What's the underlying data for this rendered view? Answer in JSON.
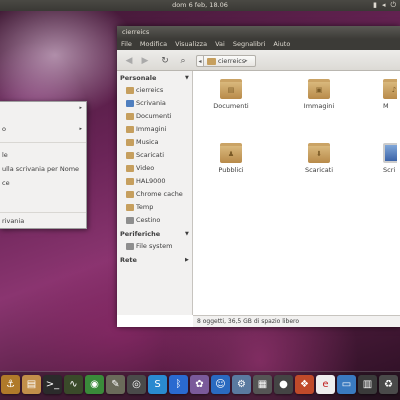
{
  "topbar": {
    "clock": "dom  6 feb, 18.06",
    "tray_icons": [
      "network-icon",
      "volume-icon",
      "power-icon"
    ]
  },
  "context_menu": {
    "items": [
      {
        "label": "",
        "submenu": true
      },
      {
        "label": "o",
        "submenu": true
      },
      {
        "label": "le",
        "submenu": false
      },
      {
        "label": "ulla scrivania per Nome",
        "submenu": false
      },
      {
        "label": "ce",
        "submenu": false
      },
      {
        "label": "rivania",
        "submenu": false
      }
    ]
  },
  "window": {
    "title": "cierreics",
    "menu": [
      "File",
      "Modifica",
      "Visualizza",
      "Vai",
      "Segnalibri",
      "Aiuto"
    ],
    "path": {
      "current": "cierreics"
    },
    "sidebar": {
      "personal_header": "Personale",
      "personal": [
        {
          "label": "cierreics",
          "icon": "home-folder-icon"
        },
        {
          "label": "Scrivania",
          "icon": "desktop-icon"
        },
        {
          "label": "Documenti",
          "icon": "folder-icon"
        },
        {
          "label": "Immagini",
          "icon": "folder-icon"
        },
        {
          "label": "Musica",
          "icon": "folder-icon"
        },
        {
          "label": "Scaricati",
          "icon": "folder-icon"
        },
        {
          "label": "Video",
          "icon": "folder-icon"
        },
        {
          "label": "HAL9000",
          "icon": "folder-icon"
        },
        {
          "label": "Chrome cache",
          "icon": "folder-icon"
        },
        {
          "label": "Temp",
          "icon": "folder-icon"
        },
        {
          "label": "Cestino",
          "icon": "trash-icon"
        }
      ],
      "devices_header": "Periferiche",
      "devices": [
        {
          "label": "File system",
          "icon": "drive-icon"
        }
      ],
      "network_header": "Rete"
    },
    "files": [
      {
        "label": "Documenti",
        "icon": "folder-documents-icon"
      },
      {
        "label": "Immagini",
        "icon": "folder-pictures-icon"
      },
      {
        "label": "M",
        "icon": "folder-music-icon"
      },
      {
        "label": "Pubblici",
        "icon": "folder-public-icon"
      },
      {
        "label": "Scaricati",
        "icon": "folder-download-icon"
      },
      {
        "label": "Scri",
        "icon": "folder-desktop-icon"
      }
    ],
    "status": "8 oggetti, 36,5 GB di spazio libero"
  },
  "dock": {
    "items": [
      {
        "name": "anchor",
        "glyph": "⚓",
        "color": "#b07a2a"
      },
      {
        "name": "files",
        "glyph": "▤",
        "color": "#c28f4a"
      },
      {
        "name": "terminal",
        "glyph": ">_",
        "color": "#2b2b2b"
      },
      {
        "name": "system-monitor",
        "glyph": "∿",
        "color": "#3a4a2a"
      },
      {
        "name": "chrome",
        "glyph": "◉",
        "color": "#3a8a3a"
      },
      {
        "name": "gimp",
        "glyph": "✎",
        "color": "#6a6a5a"
      },
      {
        "name": "disk-utility",
        "glyph": "◎",
        "color": "#4a4a4a"
      },
      {
        "name": "skype",
        "glyph": "S",
        "color": "#2a8ad0"
      },
      {
        "name": "bluetooth",
        "glyph": "ᛒ",
        "color": "#2a6ad0"
      },
      {
        "name": "photos",
        "glyph": "✿",
        "color": "#7a5a9a"
      },
      {
        "name": "finder",
        "glyph": "☺",
        "color": "#2a6ac0"
      },
      {
        "name": "settings",
        "glyph": "⚙",
        "color": "#5a7aa0"
      },
      {
        "name": "calculator",
        "glyph": "▦",
        "color": "#555555"
      },
      {
        "name": "record",
        "glyph": "●",
        "color": "#444444"
      },
      {
        "name": "store",
        "glyph": "❖",
        "color": "#c04a2a"
      },
      {
        "name": "sync",
        "glyph": "e",
        "color": "#eeeeee"
      },
      {
        "name": "window",
        "glyph": "▭",
        "color": "#3a7ac0"
      },
      {
        "name": "workspace",
        "glyph": "▥",
        "color": "#3a3a3a"
      },
      {
        "name": "trash",
        "glyph": "♻",
        "color": "#4a4a4a"
      }
    ]
  }
}
